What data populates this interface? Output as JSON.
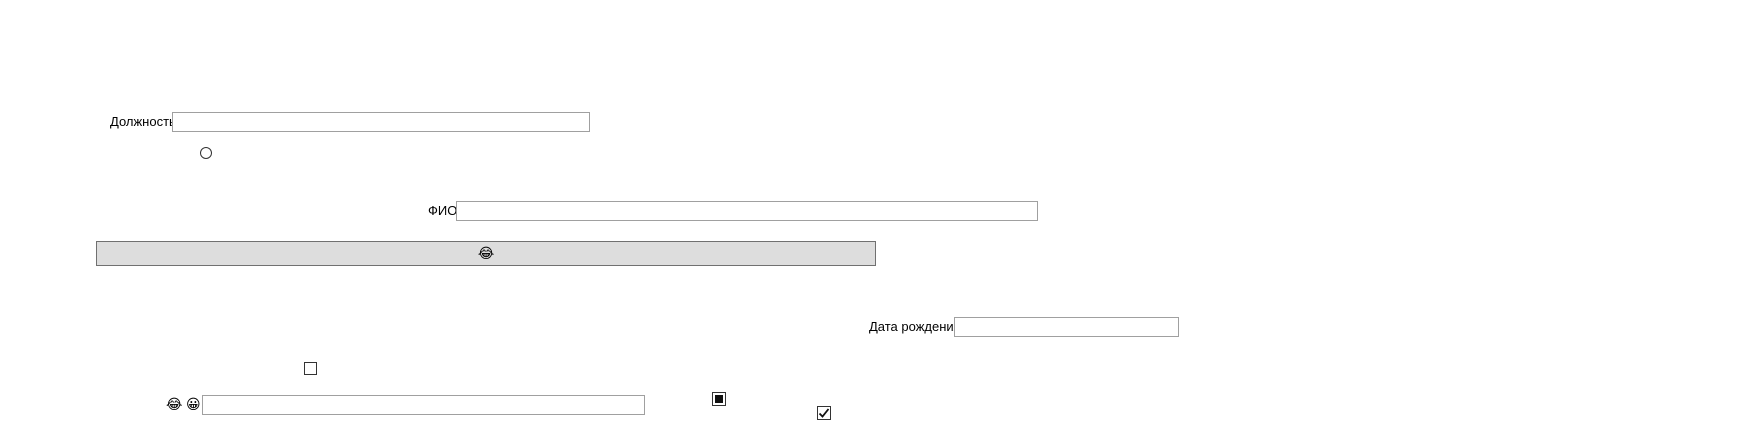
{
  "form": {
    "position_label": "Должность",
    "position_value": "",
    "fio_label": "ФИО",
    "fio_value": "",
    "birth_date_label": "Дата рождения",
    "birth_date_value": "",
    "bottom_field_value": ""
  },
  "button": {
    "icon_glyph": "😂"
  },
  "bottom_icons": {
    "first_glyph": "😂",
    "second_glyph": "😀"
  },
  "controls": {
    "radio_checked": false,
    "checkbox_plain_checked": false,
    "checkbox_indeterminate": true,
    "checkbox_checked": true
  },
  "icons": {
    "button_icon": "face-with-tears-of-joy-icon",
    "bottom_icon_1": "face-with-tears-of-joy-icon",
    "bottom_icon_2": "grinning-face-icon",
    "checkmark": "checkmark-icon"
  }
}
